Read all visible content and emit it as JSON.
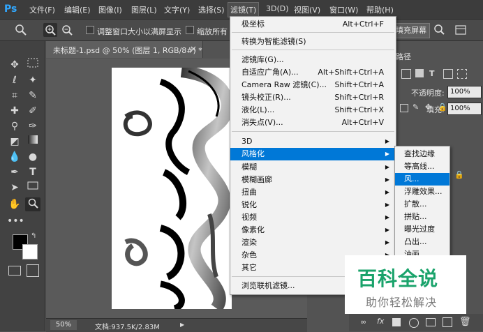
{
  "app": {
    "logo": "Ps"
  },
  "menubar": {
    "items": [
      "文件(F)",
      "编辑(E)",
      "图像(I)",
      "图层(L)",
      "文字(Y)",
      "选择(S)",
      "滤镜(T)",
      "3D(D)",
      "视图(V)",
      "窗口(W)",
      "帮助(H)"
    ]
  },
  "optbar": {
    "resize_window": "调整窗口大小以满屏显示",
    "zoom_all": "缩放所有",
    "fill_screen": "填充屏幕"
  },
  "document": {
    "tab_title": "未标题-1.psd @ 50% (图层 1, RGB/8#) *",
    "close": "×",
    "zoom": "50%",
    "doc_info": "文档:937.5K/2.83M"
  },
  "right_panel": {
    "tab": "路径",
    "opacity_label": "不透明度:",
    "opacity_value": "100%",
    "fill_label": "填充:",
    "fill_value": "100%"
  },
  "filter_menu": {
    "items": [
      {
        "label": "极坐标",
        "shortcut": "Alt+Ctrl+F"
      },
      {
        "label": "转换为智能滤镜(S)",
        "shortcut": ""
      },
      {
        "label": "滤镜库(G)...",
        "shortcut": ""
      },
      {
        "label": "自适应广角(A)...",
        "shortcut": "Alt+Shift+Ctrl+A"
      },
      {
        "label": "Camera Raw 滤镜(C)...",
        "shortcut": "Shift+Ctrl+A"
      },
      {
        "label": "镜头校正(R)...",
        "shortcut": "Shift+Ctrl+R"
      },
      {
        "label": "液化(L)...",
        "shortcut": "Shift+Ctrl+X"
      },
      {
        "label": "消失点(V)...",
        "shortcut": "Alt+Ctrl+V"
      },
      {
        "label": "3D",
        "shortcut": ""
      },
      {
        "label": "风格化",
        "shortcut": ""
      },
      {
        "label": "模糊",
        "shortcut": ""
      },
      {
        "label": "模糊画廊",
        "shortcut": ""
      },
      {
        "label": "扭曲",
        "shortcut": ""
      },
      {
        "label": "锐化",
        "shortcut": ""
      },
      {
        "label": "视频",
        "shortcut": ""
      },
      {
        "label": "像素化",
        "shortcut": ""
      },
      {
        "label": "渲染",
        "shortcut": ""
      },
      {
        "label": "杂色",
        "shortcut": ""
      },
      {
        "label": "其它",
        "shortcut": ""
      },
      {
        "label": "浏览联机滤镜...",
        "shortcut": ""
      }
    ]
  },
  "stylize_submenu": {
    "items": [
      "查找边缘",
      "等高线...",
      "风...",
      "浮雕效果...",
      "扩散...",
      "拼贴...",
      "曝光过度",
      "凸出...",
      "油画..."
    ]
  },
  "watermark": {
    "line1": "百科全说",
    "line2": "助你轻松解决"
  },
  "colors": {
    "accent": "#0078d7",
    "brand": "#31a8ff",
    "watermark_green": "#1aa36b"
  }
}
